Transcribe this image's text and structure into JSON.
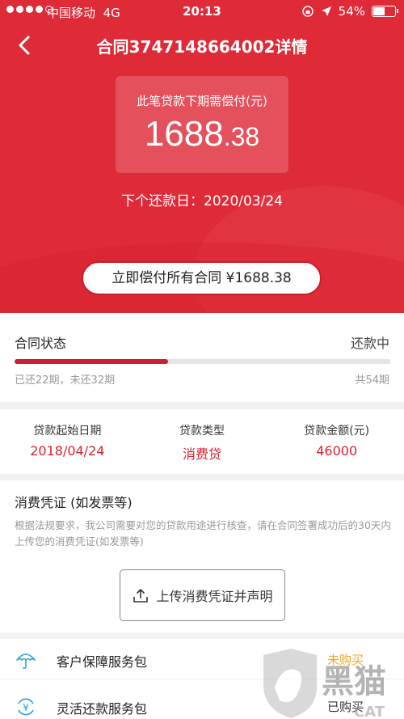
{
  "status_bar": {
    "carrier": "中国移动",
    "network": "4G",
    "time": "20:13",
    "battery": "54%"
  },
  "nav": {
    "title": "合同3747148664002详情"
  },
  "amount": {
    "label": "此笔贷款下期需偿付(元)",
    "integer": "1688",
    "decimal": ".38"
  },
  "next_date": "下个还款日：2020/03/24",
  "pay_all": "立即偿付所有合同 ¥1688.38",
  "contract_status": {
    "heading": "合同状态",
    "status": "还款中",
    "progress_fraction": 0.407,
    "paid_info": "已还22期，未还32期",
    "total_info": "共54期"
  },
  "loan_info": [
    {
      "key": "贷款起始日期",
      "value": "2018/04/24"
    },
    {
      "key": "贷款类型",
      "value": "消费贷"
    },
    {
      "key": "贷款金额(元)",
      "value": "46000"
    }
  ],
  "voucher": {
    "heading": "消费凭证 (如发票等)",
    "description": "根据法规要求，我公司需要对您的贷款用途进行核查，请在合同签署成功后的30天内上传您的消费凭证(如发票等)",
    "upload_button": "上传消费凭证并声明"
  },
  "services": [
    {
      "label": "客户保障服务包",
      "state": "未购买",
      "icon": "umbrella-icon",
      "color": "#f5a623"
    },
    {
      "label": "灵活还款服务包",
      "state": "已购买",
      "icon": "yen-refresh-icon",
      "color": "#333333"
    }
  ],
  "watermark": {
    "text": "黑猫",
    "sub": "CAT"
  }
}
